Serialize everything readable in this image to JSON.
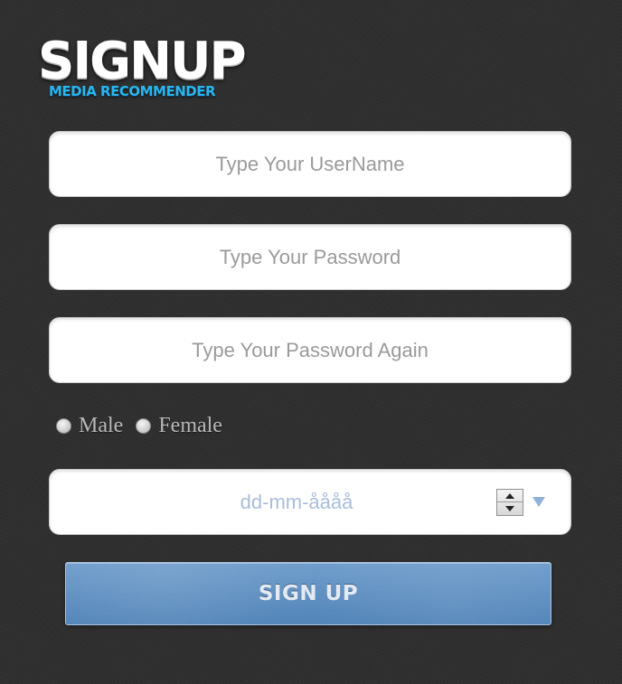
{
  "logo": {
    "title": "SIGNUP",
    "subtitle": "MEDIA RECOMMENDER"
  },
  "form": {
    "username": {
      "value": "",
      "placeholder": "Type Your UserName"
    },
    "password": {
      "value": "",
      "placeholder": "Type Your Password"
    },
    "password_again": {
      "value": "",
      "placeholder": "Type Your Password Again"
    },
    "gender": {
      "options": [
        "Male",
        "Female"
      ],
      "selected": null
    },
    "date": {
      "placeholder": "dd-mm-åååå",
      "spinner_icon": "spinner-icon",
      "dropdown_icon": "dropdown-arrow-icon"
    },
    "submit_label": "SIGN UP"
  },
  "colors": {
    "background": "#2f2f2f",
    "logo_subtitle": "#29b6ee",
    "button": "#5a8bbe",
    "date_placeholder": "#a8bddb"
  }
}
